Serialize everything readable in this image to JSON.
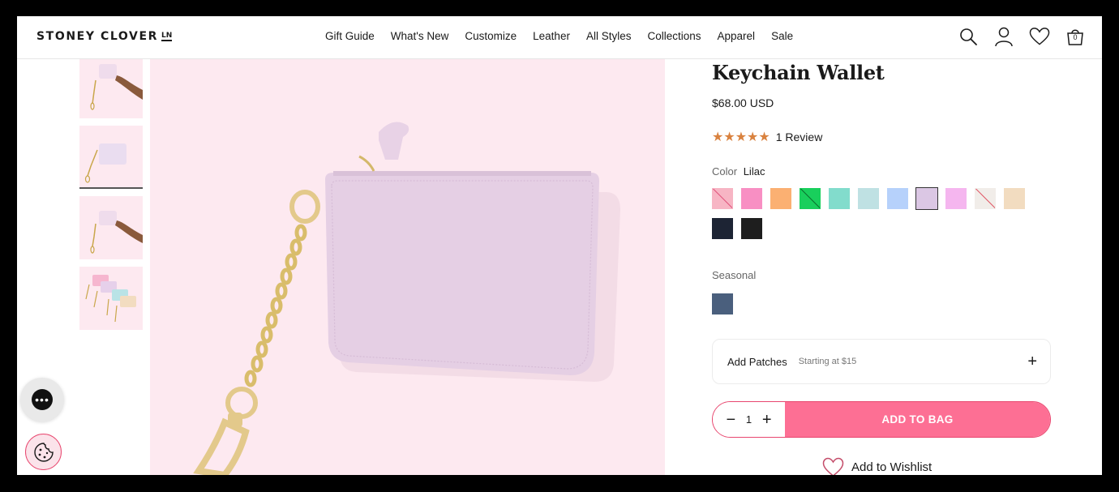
{
  "header": {
    "logo": "STONEY CLOVER",
    "logo_mark": "LN",
    "nav": [
      "Gift Guide",
      "What's New",
      "Customize",
      "Leather",
      "All Styles",
      "Collections",
      "Apparel",
      "Sale"
    ],
    "bag_count": "0",
    "icons": [
      "search-icon",
      "account-icon",
      "heart-icon",
      "bag-icon"
    ]
  },
  "product": {
    "title": "Keychain Wallet",
    "price": "$68.00 USD",
    "stars": "★★★★★",
    "rating": 5,
    "review_text": "1 Review",
    "color_label": "Color",
    "color_value": "Lilac",
    "swatches": [
      {
        "name": "Pink Slash",
        "color": "#f7b5c4",
        "slash": "#e0507a",
        "sold_out": true
      },
      {
        "name": "Bubblegum",
        "color": "#f88fc3",
        "sold_out": false
      },
      {
        "name": "Peach",
        "color": "#fbb072",
        "sold_out": false
      },
      {
        "name": "Green",
        "color": "#19cf5c",
        "slash": "#0b6b2c",
        "sold_out": true
      },
      {
        "name": "Seafoam",
        "color": "#82dccc",
        "sold_out": false
      },
      {
        "name": "Sky",
        "color": "#bfe1e3",
        "sold_out": false
      },
      {
        "name": "Periwinkle",
        "color": "#b6d1fb",
        "sold_out": false
      },
      {
        "name": "Lilac",
        "color": "#dbc7e4",
        "sold_out": false,
        "selected": true
      },
      {
        "name": "Orchid",
        "color": "#f5b6ef",
        "sold_out": false
      },
      {
        "name": "White",
        "color": "#f1ede9",
        "slash": "#e05060",
        "sold_out": true
      },
      {
        "name": "Sand",
        "color": "#f2dcc0",
        "sold_out": false
      },
      {
        "name": "Navy",
        "color": "#1d2434",
        "sold_out": false
      },
      {
        "name": "Black",
        "color": "#1e1e1e",
        "sold_out": false
      }
    ],
    "seasonal_label": "Seasonal",
    "seasonal_swatch": {
      "name": "Denim",
      "color": "#4a5f7d"
    },
    "patches_title": "Add Patches",
    "patches_sub": "Starting at $15",
    "patches_plus": "+",
    "quantity": "1",
    "qty_minus": "−",
    "qty_plus": "+",
    "add_to_bag": "ADD TO BAG",
    "wishlist": "Add to Wishlist"
  },
  "colors": {
    "accent": "#fd6f94",
    "accent_border": "#e8476f",
    "image_bg": "#fde9f0",
    "wallet": "#e5cfe4",
    "star": "#d9823f"
  }
}
